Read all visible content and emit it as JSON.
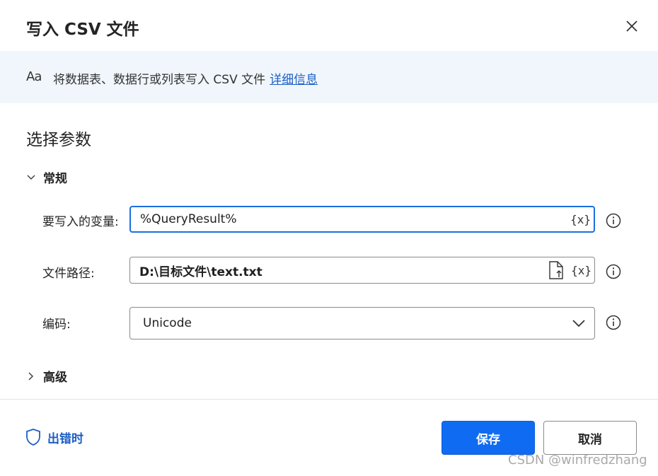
{
  "dialog": {
    "title": "写入 CSV 文件",
    "close_icon": "close-icon"
  },
  "banner": {
    "icon_text": "Aa",
    "description": "将数据表、数据行或列表写入 CSV 文件",
    "more_link": "详细信息"
  },
  "section": {
    "title": "选择参数"
  },
  "groups": {
    "general": "常规",
    "advanced": "高级"
  },
  "fields": {
    "variable": {
      "label": "要写入的变量:",
      "value": "%QueryResult%",
      "var_icon": "{x}"
    },
    "file_path": {
      "label": "文件路径:",
      "value": "D:\\目标文件\\text.txt",
      "var_icon": "{x}"
    },
    "encoding": {
      "label": "编码:",
      "value": "Unicode"
    }
  },
  "footer": {
    "on_error": "出错时",
    "save": "保存",
    "cancel": "取消"
  },
  "watermark": "CSDN @winfredzhang",
  "colors": {
    "accent": "#0f6cf2",
    "link": "#1d5fc4",
    "banner_bg": "#f0f6fc",
    "focus_border": "#1a6fe0"
  }
}
